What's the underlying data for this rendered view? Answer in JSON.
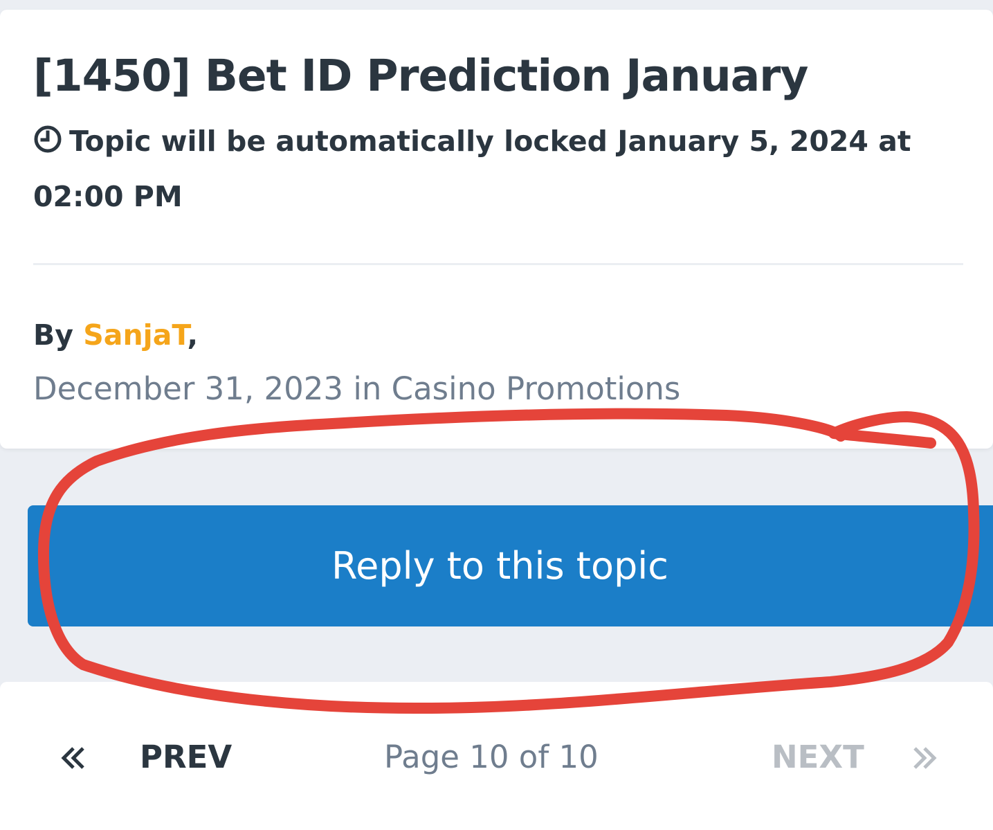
{
  "topic": {
    "title": "[1450] Bet ID Prediction January",
    "lock_notice": "Topic will be automatically locked January 5, 2024 at 02:00 PM",
    "lock_icon": "clock-icon",
    "by_label": "By",
    "author": "SanjaT",
    "author_suffix": ",",
    "meta": "December 31, 2023 in Casino Promotions",
    "author_color": "#f5a51a"
  },
  "actions": {
    "reply_label": "Reply to this topic",
    "reply_color": "#1b7ec8"
  },
  "pagination": {
    "prev_icon": "double-chevron-left-icon",
    "prev_label": "PREV",
    "page_label": "Page 10 of 10",
    "next_label": "NEXT",
    "next_icon": "double-chevron-right-icon",
    "next_disabled": true
  },
  "annotation": {
    "type": "hand-drawn circle",
    "color": "#e5443a",
    "highlights": "reply-button"
  }
}
